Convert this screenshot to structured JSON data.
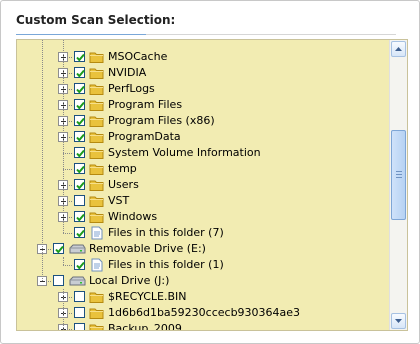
{
  "panel": {
    "title": "Custom Scan Selection:"
  },
  "tree": {
    "rows": [
      {
        "label": "MSOCache",
        "checked": true,
        "icon": "folder-icon"
      },
      {
        "label": "NVIDIA",
        "checked": true,
        "icon": "folder-icon"
      },
      {
        "label": "PerfLogs",
        "checked": true,
        "icon": "folder-icon"
      },
      {
        "label": "Program Files",
        "checked": true,
        "icon": "folder-icon"
      },
      {
        "label": "Program Files (x86)",
        "checked": true,
        "icon": "folder-icon"
      },
      {
        "label": "ProgramData",
        "checked": true,
        "icon": "folder-icon"
      },
      {
        "label": "System Volume Information",
        "checked": true,
        "icon": "folder-icon"
      },
      {
        "label": "temp",
        "checked": true,
        "icon": "folder-icon"
      },
      {
        "label": "Users",
        "checked": true,
        "icon": "folder-icon"
      },
      {
        "label": "VST",
        "checked": false,
        "icon": "folder-icon"
      },
      {
        "label": "Windows",
        "checked": true,
        "icon": "folder-icon"
      },
      {
        "label": "Files in this folder (7)",
        "checked": true,
        "icon": "files-icon"
      },
      {
        "label": "Removable Drive (E:)",
        "checked": true,
        "icon": "drive-icon"
      },
      {
        "label": "Files in this folder (1)",
        "checked": true,
        "icon": "files-icon"
      },
      {
        "label": "Local Drive (J:)",
        "checked": false,
        "icon": "drive-icon"
      },
      {
        "label": "$RECYCLE.BIN",
        "checked": false,
        "icon": "folder-icon"
      },
      {
        "label": "1d6b6d1ba59230ccecb930364ae3",
        "checked": false,
        "icon": "folder-icon"
      },
      {
        "label": "Backup_2009",
        "checked": false,
        "icon": "folder-icon"
      }
    ]
  },
  "colors": {
    "tree_background": "#f2ecb2",
    "checkbox_border": "#1c5180",
    "checkmark": "#1a9b1a",
    "scrollbar_accent": "#7ea6d6"
  }
}
